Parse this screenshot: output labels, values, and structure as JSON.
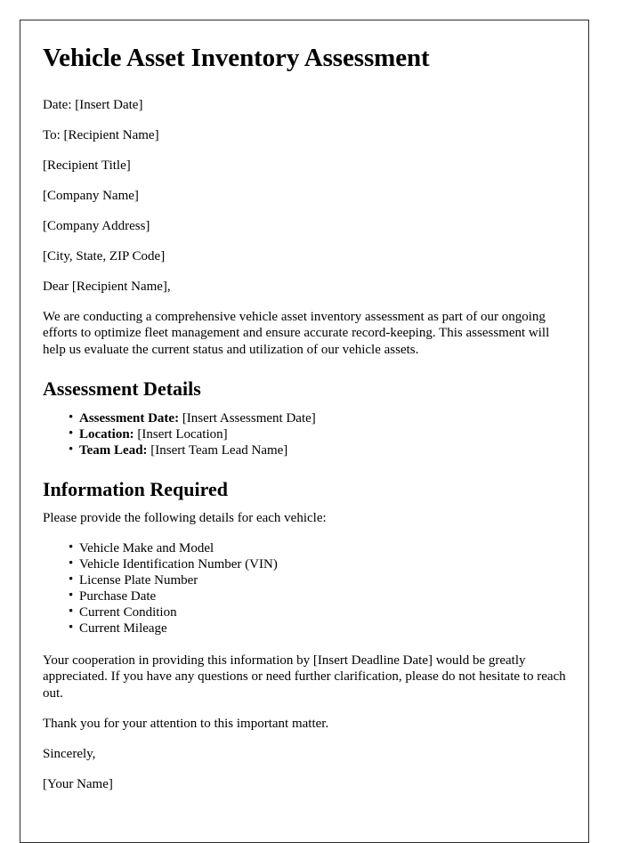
{
  "document": {
    "title": "Vehicle Asset Inventory Assessment",
    "header_lines": [
      "Date: [Insert Date]",
      "To: [Recipient Name]",
      "[Recipient Title]",
      "[Company Name]",
      "[Company Address]",
      "[City, State, ZIP Code]",
      "Dear [Recipient Name],"
    ],
    "intro_paragraph": "We are conducting a comprehensive vehicle asset inventory assessment as part of our ongoing efforts to optimize fleet management and ensure accurate record-keeping. This assessment will help us evaluate the current status and utilization of our vehicle assets.",
    "assessment_details": {
      "heading": "Assessment Details",
      "items": [
        {
          "label": "Assessment Date:",
          "value": "[Insert Assessment Date]"
        },
        {
          "label": "Location:",
          "value": "[Insert Location]"
        },
        {
          "label": "Team Lead:",
          "value": "[Insert Team Lead Name]"
        }
      ]
    },
    "information_required": {
      "heading": "Information Required",
      "intro": "Please provide the following details for each vehicle:",
      "items": [
        "Vehicle Make and Model",
        "Vehicle Identification Number (VIN)",
        "License Plate Number",
        "Purchase Date",
        "Current Condition",
        "Current Mileage"
      ]
    },
    "closing_paragraph": "Your cooperation in providing this information by [Insert Deadline Date] would be greatly appreciated. If you have any questions or need further clarification, please do not hesitate to reach out.",
    "thank_you": "Thank you for your attention to this important matter.",
    "sign_off": "Sincerely,",
    "signature_name": "[Your Name]"
  },
  "style": {
    "page_border_color": "#2b2b2b",
    "text_color": "#000000",
    "background_color": "#ffffff"
  }
}
